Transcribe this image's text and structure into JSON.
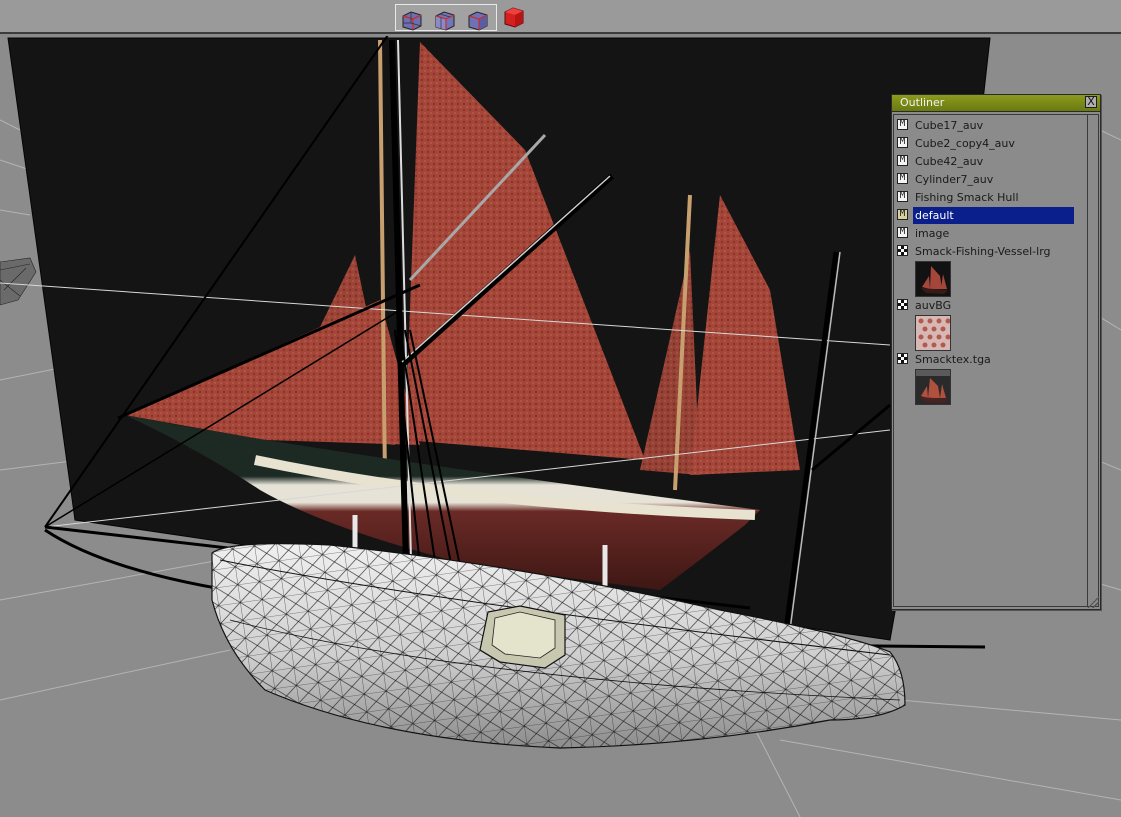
{
  "toolbar": {
    "view_buttons": [
      {
        "icon": "wireframe-cube-icon"
      },
      {
        "icon": "shaded-wire-cube-icon"
      },
      {
        "icon": "smooth-cube-icon"
      },
      {
        "icon": "solid-red-cube-icon"
      }
    ]
  },
  "outliner": {
    "title": "Outliner",
    "close_label": "X",
    "items": [
      {
        "label": "Cube17_auv",
        "type": "mesh",
        "marker": "M"
      },
      {
        "label": "Cube2_copy4_auv",
        "type": "mesh",
        "marker": "M"
      },
      {
        "label": "Cube42_auv",
        "type": "mesh",
        "marker": "M"
      },
      {
        "label": "Cylinder7_auv",
        "type": "mesh",
        "marker": "M"
      },
      {
        "label": "Fishing Smack Hull",
        "type": "mesh",
        "marker": "M"
      },
      {
        "label": "default",
        "type": "material",
        "marker": "M",
        "selected": true
      },
      {
        "label": "image",
        "type": "mesh",
        "marker": "M"
      },
      {
        "label": "Smack-Fishing-Vessel-lrg",
        "type": "texture"
      },
      {
        "label": "auvBG",
        "type": "texture"
      },
      {
        "label": "Smacktex.tga",
        "type": "texture"
      }
    ]
  },
  "colors": {
    "selection": "#0b1f8c",
    "title_bar": "#7a8a14",
    "sail": "#a5483a",
    "background_plane": "#141414",
    "viewport_bg": "#8c8c8c"
  }
}
